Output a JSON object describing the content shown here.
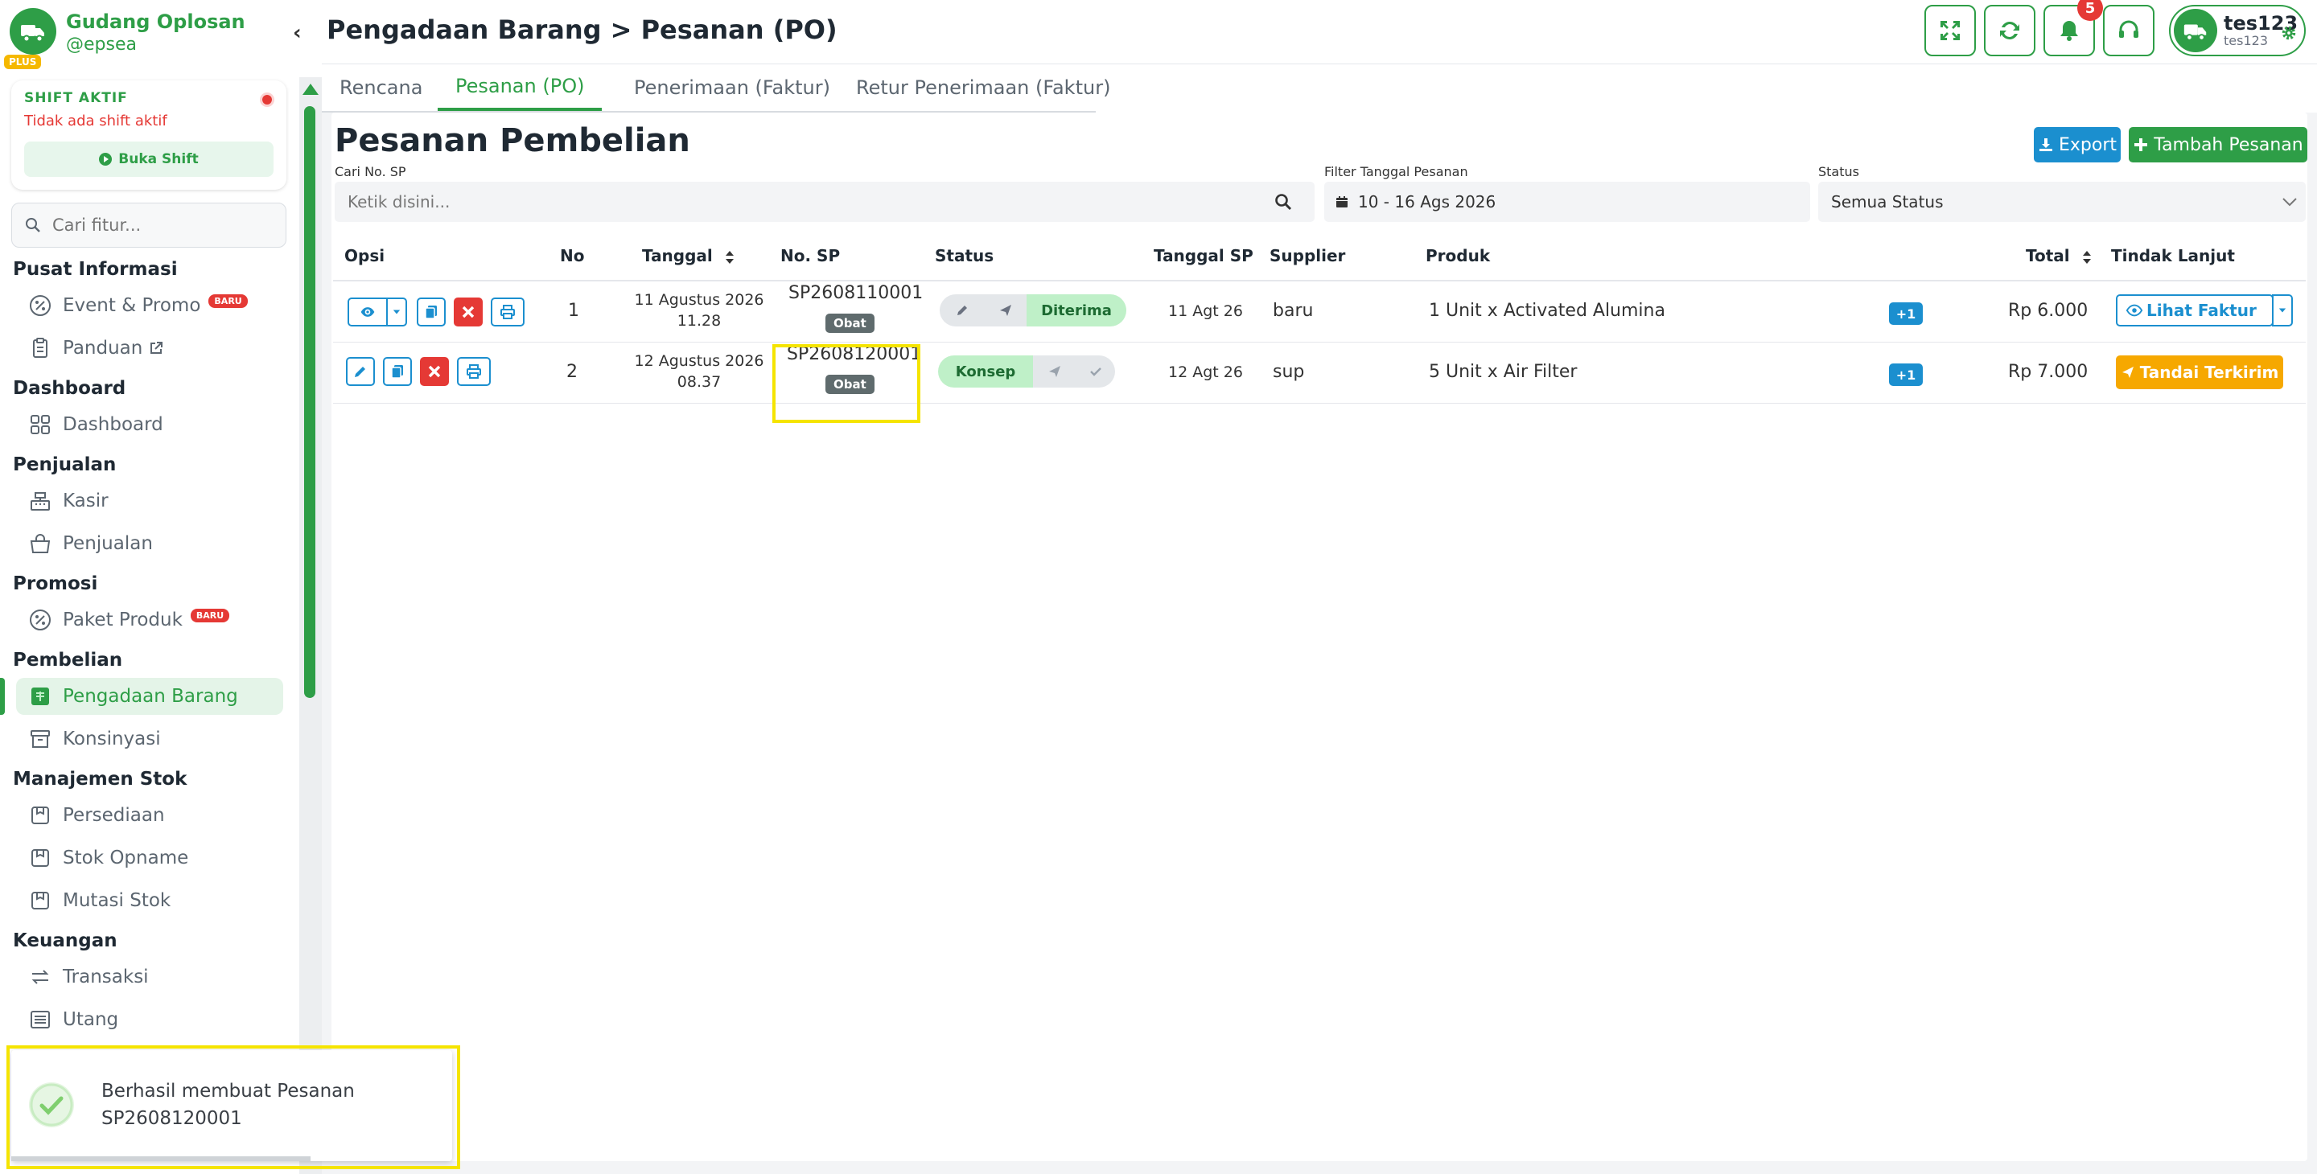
{
  "brand": {
    "name": "Gudang Oplosan",
    "user": "@epsea",
    "plan": "PLUS"
  },
  "shift": {
    "title": "SHIFT AKTIF",
    "status": "Tidak ada shift aktif",
    "button": "Buka Shift"
  },
  "sidebar_search": {
    "placeholder": "Cari fitur..."
  },
  "nav": [
    {
      "section": "Pusat Informasi",
      "items": [
        {
          "label": "Event & Promo",
          "icon": "percent-icon",
          "badge": "BARU"
        },
        {
          "label": "Panduan",
          "icon": "clipboard-icon",
          "external": true
        }
      ]
    },
    {
      "section": "Dashboard",
      "items": [
        {
          "label": "Dashboard",
          "icon": "grid-icon"
        }
      ]
    },
    {
      "section": "Penjualan",
      "items": [
        {
          "label": "Kasir",
          "icon": "cash-register-icon"
        },
        {
          "label": "Penjualan",
          "icon": "basket-icon"
        }
      ]
    },
    {
      "section": "Promosi",
      "items": [
        {
          "label": "Paket Produk",
          "icon": "percent-icon",
          "badge": "BARU"
        }
      ]
    },
    {
      "section": "Pembelian",
      "items": [
        {
          "label": "Pengadaan Barang",
          "icon": "purchase-icon",
          "active": true
        },
        {
          "label": "Konsinyasi",
          "icon": "archive-icon"
        }
      ]
    },
    {
      "section": "Manajemen Stok",
      "items": [
        {
          "label": "Persediaan",
          "icon": "box-icon"
        },
        {
          "label": "Stok Opname",
          "icon": "box-icon"
        },
        {
          "label": "Mutasi Stok",
          "icon": "box-icon"
        }
      ]
    },
    {
      "section": "Keuangan",
      "items": [
        {
          "label": "Transaksi",
          "icon": "exchange-icon"
        },
        {
          "label": "Utang",
          "icon": "list-icon"
        }
      ]
    }
  ],
  "header": {
    "breadcrumb": "Pengadaan Barang > Pesanan (PO)",
    "notifications": "5",
    "user_name": "tes123",
    "user_sub": "tes123"
  },
  "tabs": [
    {
      "label": "Rencana"
    },
    {
      "label": "Pesanan (PO)",
      "active": true
    },
    {
      "label": "Penerimaan (Faktur)"
    },
    {
      "label": "Retur Penerimaan (Faktur)"
    }
  ],
  "main": {
    "title": "Pesanan Pembelian",
    "export_label": "Export",
    "add_label": "Tambah Pesanan",
    "filters": {
      "sp_label": "Cari No. SP",
      "sp_placeholder": "Ketik disini...",
      "date_label": "Filter Tanggal Pesanan",
      "date_value": "10 - 16 Ags 2026",
      "status_label": "Status",
      "status_value": "Semua Status"
    }
  },
  "table": {
    "columns": [
      "Opsi",
      "No",
      "Tanggal",
      "No. SP",
      "Status",
      "Tanggal SP",
      "Supplier",
      "Produk",
      "Total",
      "Tindak Lanjut"
    ],
    "rows": [
      {
        "no": "1",
        "date1": "11 Agustus 2026",
        "date2": "11.28",
        "sp": "SP2608110001",
        "category": "Obat",
        "status": "Diterima",
        "tanggal_sp": "11 Agt 26",
        "supplier": "baru",
        "produk": "1 Unit x Activated Alumina",
        "more": "+1",
        "total": "Rp 6.000",
        "action": "Lihat Faktur"
      },
      {
        "no": "2",
        "date1": "12 Agustus 2026",
        "date2": "08.37",
        "sp": "SP2608120001",
        "category": "Obat",
        "status": "Konsep",
        "tanggal_sp": "12 Agt 26",
        "supplier": "sup",
        "produk": "5 Unit x Air Filter",
        "more": "+1",
        "total": "Rp 7.000",
        "action": "Tandai Terkirim"
      }
    ]
  },
  "toast": {
    "line1": "Berhasil membuat Pesanan",
    "line2": "SP2608120001"
  },
  "colors": {
    "primary": "#2e9e47",
    "info": "#1b8fcf",
    "danger": "#e53935",
    "warning": "#f6a800",
    "highlight": "#f5e400"
  }
}
